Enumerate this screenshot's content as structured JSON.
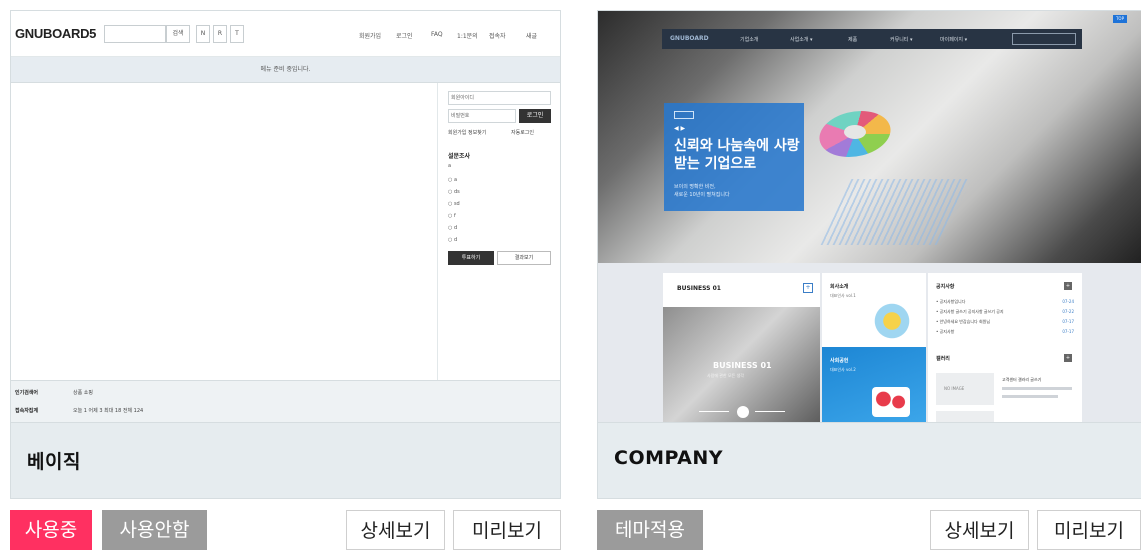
{
  "themes": [
    {
      "name": "베이직",
      "buttons": {
        "active": "사용중",
        "deactivate": "사용안함",
        "detail": "상세보기",
        "preview": "미리보기"
      },
      "mock": {
        "logo": "GNUBOARD5",
        "search_btn": "검색",
        "mini_btns": [
          "N",
          "R",
          "T"
        ],
        "nav": [
          "회원가입",
          "로그인",
          "FAQ",
          "1:1문의",
          "접속자",
          "새글"
        ],
        "notice": "메뉴 준비 중입니다.",
        "login": {
          "id": "회원아이디",
          "pw": "비밀번호",
          "submit": "로그인",
          "links": "회원가입  정보찾기",
          "auto": "자동로그인"
        },
        "poll": {
          "title": "설문조사",
          "q": "a",
          "options": [
            "a",
            "ds",
            "sd",
            "f",
            "d",
            "d"
          ],
          "vote": "투표하기",
          "result": "결과보기"
        },
        "footer": {
          "row1_label": "인기검색어",
          "row1_value": "상품   쇼핑",
          "row2_label": "접속자집계",
          "row2_value": "오늘  1      어제  3      최대  18      전체  124"
        }
      }
    },
    {
      "name": "COMPANY",
      "buttons": {
        "apply": "테마적용",
        "detail": "상세보기",
        "preview": "미리보기"
      },
      "mock": {
        "badge": "TOP",
        "logo": "GNUBOARD",
        "nav": [
          "기업소개",
          "사업소개  ▾",
          "제품",
          "커뮤니티  ▾",
          "마이페이지  ▾"
        ],
        "banner_small": "◀ ▶",
        "banner_title": "신뢰와 나눔속에 사랑받는 기업으로",
        "banner_sub": [
          "브이의 명확한 비전,",
          "새로운 10년이 펼쳐집니다"
        ],
        "business_title": "BUSINESS 01",
        "business_caption": "BUSINESS 01",
        "business_sub": "사람에 관한 모든 생각",
        "box2_title": "회사소개",
        "box2_sub": "대표인사 vol.1",
        "box3_title": "사회공헌",
        "box3_sub": "대표인사 vol.2",
        "notice_title": "공지사항",
        "notice_list": [
          {
            "t": "• 공지사항입니다",
            "d": "07-24"
          },
          {
            "t": "• 공지사항 글쓰기 공지사항 글쓰기 공지",
            "d": "07-22"
          },
          {
            "t": "• 안녕하세요 반갑습니다 회원님",
            "d": "07-17"
          },
          {
            "t": "• 공지사항",
            "d": "07-17"
          }
        ],
        "gallery_title": "갤러리",
        "gallery_thumb": "NO IMAGE",
        "gallery_text": "고객센터 갤러리 글쓰기"
      }
    }
  ]
}
